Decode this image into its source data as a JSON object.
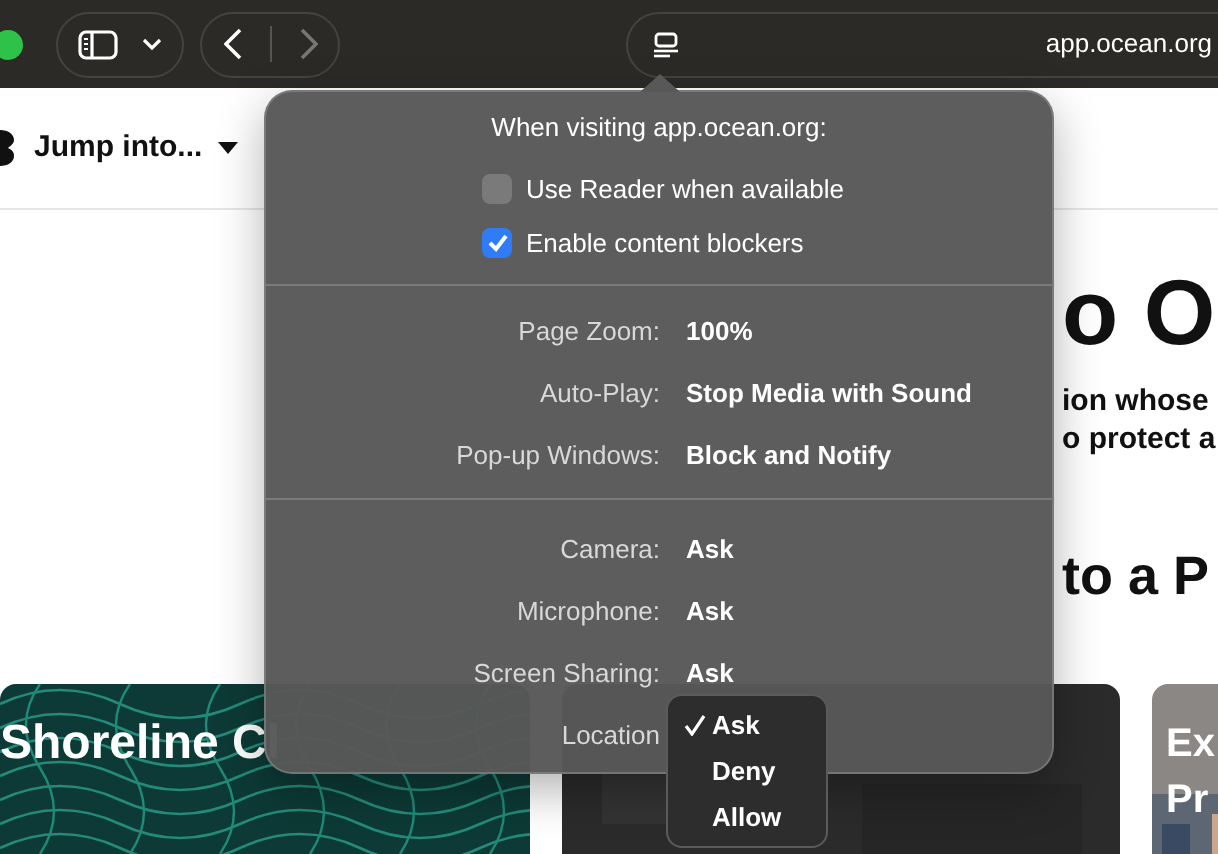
{
  "toolbar": {
    "address": "app.ocean.org"
  },
  "site_nav": {
    "menu_label": "Jump into..."
  },
  "hero": {
    "heading_fragment": "o O",
    "text_fragments": [
      "ion whose",
      "o protect a"
    ],
    "section_heading_fragment": "to a P"
  },
  "cards": [
    {
      "title_lines": [
        "Shoreline Cl"
      ],
      "kind": "net"
    },
    {
      "kind": "dark"
    },
    {
      "title_lines": [
        "Ex",
        "Pr"
      ],
      "kind": "building"
    }
  ],
  "popover": {
    "title": "When visiting app.ocean.org:",
    "checkboxes": [
      {
        "label": "Use Reader when available",
        "checked": false
      },
      {
        "label": "Enable content blockers",
        "checked": true
      }
    ],
    "settings": [
      {
        "label": "Page Zoom:",
        "value": "100%"
      },
      {
        "label": "Auto-Play:",
        "value": "Stop Media with Sound"
      },
      {
        "label": "Pop-up Windows:",
        "value": "Block and Notify"
      }
    ],
    "permissions": [
      {
        "label": "Camera:",
        "value": "Ask"
      },
      {
        "label": "Microphone:",
        "value": "Ask"
      },
      {
        "label": "Screen Sharing:",
        "value": "Ask"
      },
      {
        "label": "Location"
      }
    ],
    "location_menu": [
      {
        "label": "Ask",
        "selected": true
      },
      {
        "label": "Deny",
        "selected": false
      },
      {
        "label": "Allow",
        "selected": false
      }
    ]
  }
}
